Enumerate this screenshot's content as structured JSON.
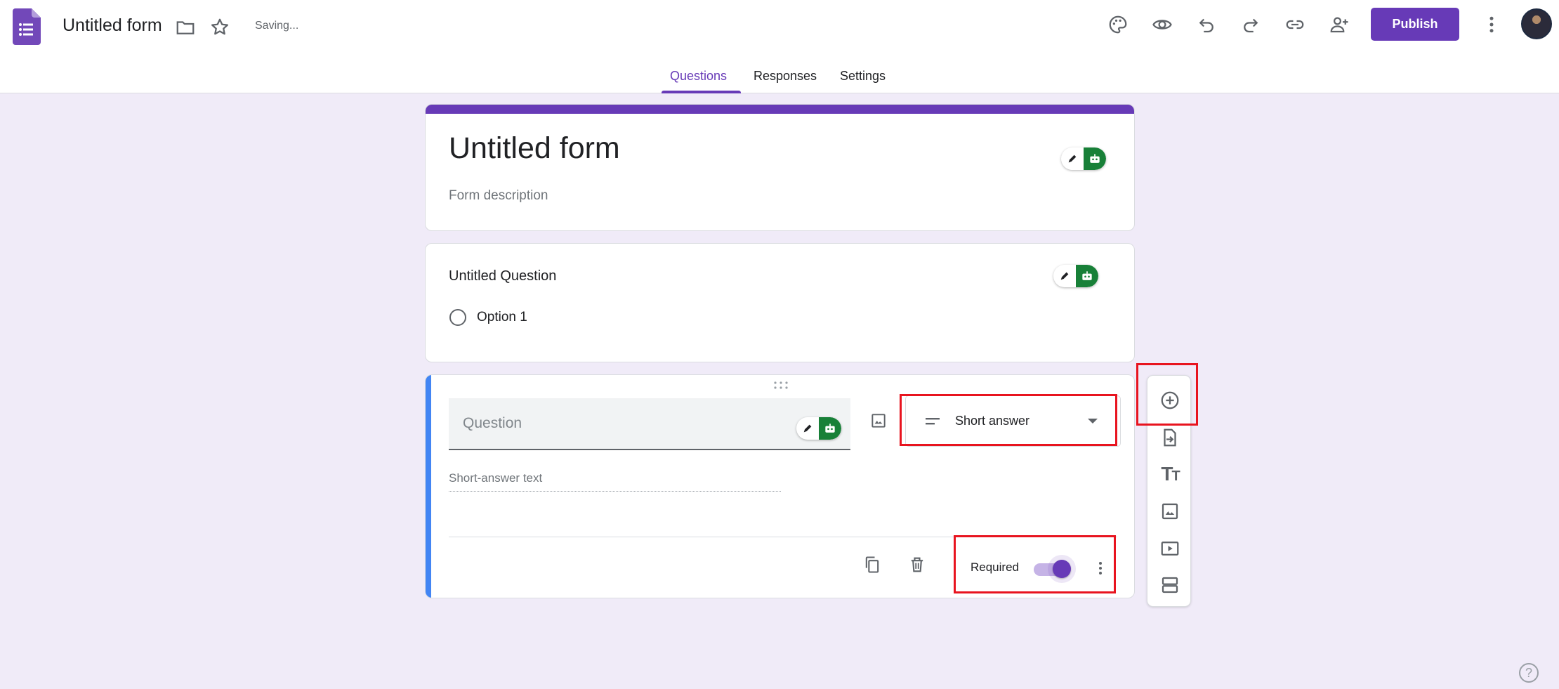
{
  "header": {
    "doc_title": "Untitled form",
    "saving_status": "Saving...",
    "publish_label": "Publish"
  },
  "tabs": [
    {
      "label": "Questions",
      "active": true
    },
    {
      "label": "Responses",
      "active": false
    },
    {
      "label": "Settings",
      "active": false
    }
  ],
  "title_card": {
    "title": "Untitled form",
    "description_placeholder": "Form description"
  },
  "question1": {
    "title": "Untitled Question",
    "options": [
      "Option 1"
    ]
  },
  "question2": {
    "question_placeholder": "Question",
    "type_label": "Short answer",
    "answer_hint": "Short-answer text",
    "required_label": "Required",
    "required_on": true
  },
  "help": {
    "symbol": "?"
  },
  "icons": {
    "header": [
      "forms-logo-icon",
      "folder-icon",
      "star-icon",
      "palette-icon",
      "preview-eye-icon",
      "undo-icon",
      "redo-icon",
      "link-icon",
      "add-collaborator-icon",
      "more-vert-icon"
    ],
    "toolbar": [
      "add-question-icon",
      "import-questions-icon",
      "add-title-icon",
      "add-image-icon",
      "add-video-icon",
      "add-section-icon"
    ]
  },
  "colors": {
    "brand": "#673ab7",
    "background": "#f0ebf8",
    "active_question_accent": "#4285f4",
    "highlight": "#e8141f",
    "ai_chip": "#188038"
  }
}
